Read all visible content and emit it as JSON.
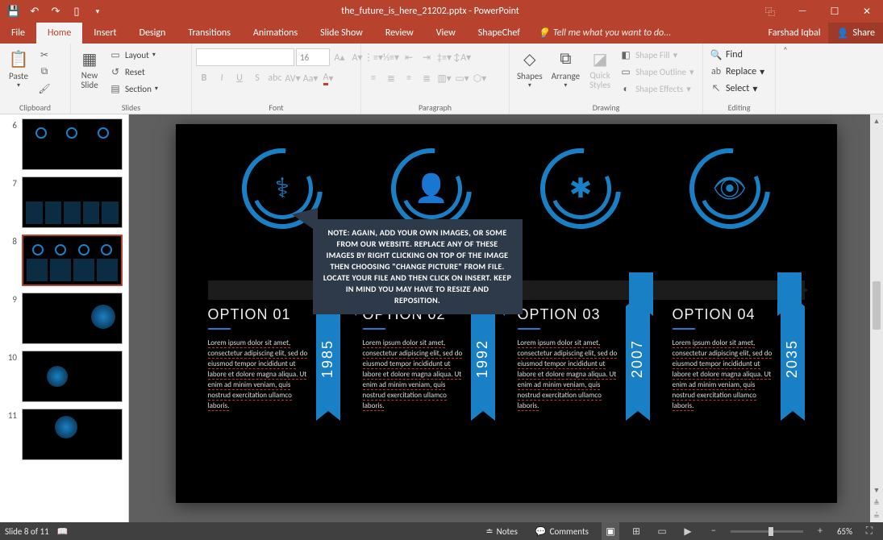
{
  "titlebar": {
    "filename": "the_future_is_here_21202.pptx - PowerPoint"
  },
  "window": {
    "display": "⿻",
    "minimize": "—",
    "maximize": "☐",
    "close": "✕"
  },
  "tabs": {
    "file": "File",
    "home": "Home",
    "insert": "Insert",
    "design": "Design",
    "transitions": "Transitions",
    "animations": "Animations",
    "slideshow": "Slide Show",
    "review": "Review",
    "view": "View",
    "shapechef": "ShapeChef",
    "tellme": "Tell me what you want to do...",
    "user": "Farshad Iqbal",
    "share": "Share"
  },
  "ribbon": {
    "clipboard": {
      "label": "Clipboard",
      "paste": "Paste"
    },
    "slides": {
      "label": "Slides",
      "newslide": "New\nSlide",
      "layout": "Layout",
      "reset": "Reset",
      "section": "Section"
    },
    "font": {
      "label": "Font",
      "size": "16"
    },
    "paragraph": {
      "label": "Paragraph"
    },
    "drawing": {
      "label": "Drawing",
      "shapes": "Shapes",
      "arrange": "Arrange",
      "quick": "Quick\nStyles",
      "fill": "Shape Fill",
      "outline": "Shape Outline",
      "effects": "Shape Effects"
    },
    "editing": {
      "label": "Editing",
      "find": "Find",
      "replace": "Replace",
      "select": "Select"
    }
  },
  "thumbnails": [
    {
      "num": "6",
      "sel": false
    },
    {
      "num": "7",
      "sel": false
    },
    {
      "num": "8",
      "sel": true
    },
    {
      "num": "9",
      "sel": false
    },
    {
      "num": "10",
      "sel": false
    },
    {
      "num": "11",
      "sel": false
    }
  ],
  "slide": {
    "options": [
      {
        "title": "OPTION 01",
        "year": "1985"
      },
      {
        "title": "OPTION 02",
        "year": "1992"
      },
      {
        "title": "OPTION 03",
        "year": "2007"
      },
      {
        "title": "OPTION 04",
        "year": "2035"
      }
    ],
    "lorem": "Lorem ipsum dolor sit amet, consectetur adipiscing elit, sed do eiusmod tempor incididunt ut labore et dolore magna aliqua. Ut enim ad minim veniam, quis nostrud exercitation ullamco laboris.",
    "callout": "NOTE: AGAIN, ADD YOUR OWN IMAGES, OR SOME FROM OUR WEBSITE. REPLACE ANY OF THESE IMAGES BY RIGHT CLICKING ON TOP OF THE IMAGE THEN CHOOSING \"CHANGE PICTURE\" FROM FILE. LOCATE YOUR FILE AND THEN CLICK ON INSERT. KEEP IN MIND YOU MAY HAVE TO RESIZE AND REPOSITION.",
    "icons": [
      "dna-icon",
      "doctor-icon",
      "network-icon",
      "eye-icon"
    ]
  },
  "status": {
    "slideinfo": "Slide 8 of 11",
    "notes": "Notes",
    "comments": "Comments",
    "zoom": "65%"
  }
}
